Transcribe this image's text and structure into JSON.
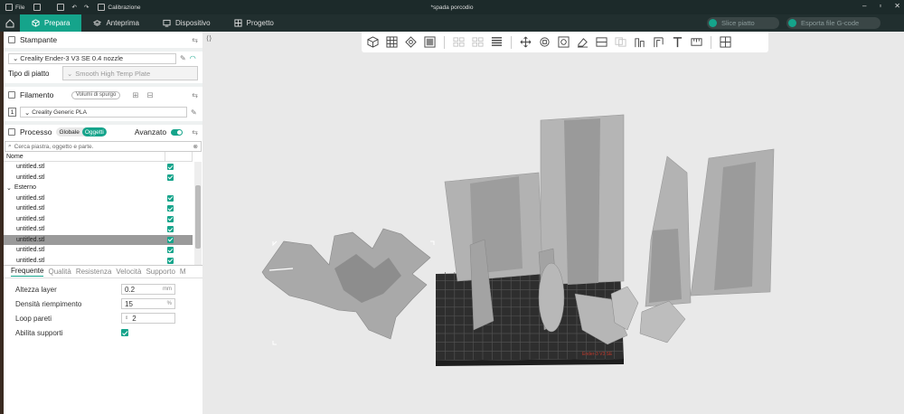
{
  "titlebar": {
    "file_label": "File",
    "calibration_label": "Calibrazione",
    "document_title": "*spada porcodio"
  },
  "menubar": {
    "tabs": [
      {
        "label": "Prepara",
        "active": true,
        "icon": "cube-icon"
      },
      {
        "label": "Anteprima",
        "active": false,
        "icon": "layers-icon"
      },
      {
        "label": "Dispositivo",
        "active": false,
        "icon": "monitor-icon"
      },
      {
        "label": "Progetto",
        "active": false,
        "icon": "grid-icon"
      }
    ],
    "slice_label": "Slice piatto",
    "export_label": "Esporta file G-code"
  },
  "printer": {
    "title": "Stampante",
    "selected": "Creality Ender-3 V3 SE 0.4 nozzle",
    "plate_type_label": "Tipo di piatto",
    "plate_type_value": "Smooth High Temp Plate"
  },
  "filament": {
    "title": "Filamento",
    "purge_button": "Volumi di spurgo",
    "slot_number": "1",
    "selected": "Creality Generic PLA"
  },
  "process": {
    "title": "Processo",
    "segment_global": "Globale",
    "segment_objects": "Oggetti",
    "advanced_label": "Avanzato",
    "search_placeholder": "Cerca piastra, oggetto e parte."
  },
  "object_tree": {
    "header_name": "Nome",
    "items": [
      {
        "label": "untitled.stl",
        "indent": 1,
        "checked": true,
        "selected": false
      },
      {
        "label": "untitled.stl",
        "indent": 1,
        "checked": true,
        "selected": false
      },
      {
        "label": "Esterno",
        "indent": 0,
        "checked": false,
        "selected": false,
        "group": true
      },
      {
        "label": "untitled.stl",
        "indent": 1,
        "checked": true,
        "selected": false
      },
      {
        "label": "untitled.stl",
        "indent": 1,
        "checked": true,
        "selected": false
      },
      {
        "label": "untitled.stl",
        "indent": 1,
        "checked": true,
        "selected": false
      },
      {
        "label": "untitled.stl",
        "indent": 1,
        "checked": true,
        "selected": false
      },
      {
        "label": "untitled.stl",
        "indent": 1,
        "checked": true,
        "selected": true
      },
      {
        "label": "untitled.stl",
        "indent": 1,
        "checked": true,
        "selected": false
      },
      {
        "label": "untitled.stl",
        "indent": 1,
        "checked": true,
        "selected": false
      }
    ]
  },
  "settings_tabs": [
    "Frequente",
    "Qualità",
    "Resistenza",
    "Velocità",
    "Supporto",
    "M"
  ],
  "settings": {
    "layer_height_label": "Altezza layer",
    "layer_height_value": "0.2",
    "layer_height_unit": "mm",
    "infill_label": "Densità riempimento",
    "infill_value": "15",
    "infill_unit": "%",
    "walls_label": "Loop pareti",
    "walls_value": "2",
    "supports_label": "Abilita supporti",
    "supports_checked": true
  },
  "colors": {
    "accent": "#15a48b",
    "titlebar": "#1c2a2a",
    "viewport": "#e9e9e9",
    "model": "#a9a9a9",
    "bed": "#2e2e2e"
  },
  "bed_label": "Ender-3 V3 SE"
}
